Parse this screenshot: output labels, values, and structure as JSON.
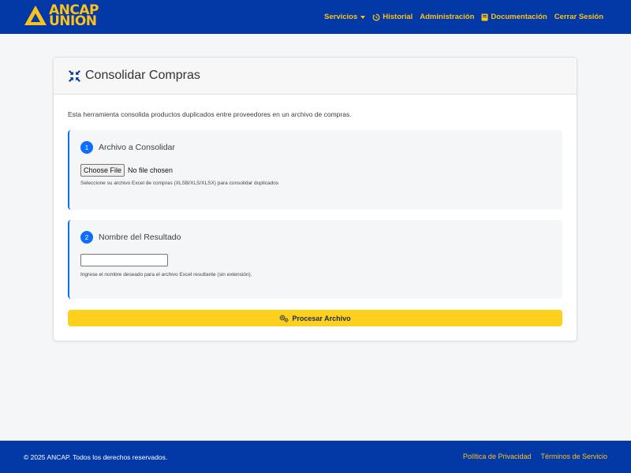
{
  "brand": {
    "line1": "ANCAP",
    "line2": "UNION",
    "color": "#fbc21b",
    "icon": "ancap-triangle-logo"
  },
  "nav": {
    "servicios": "Servicios",
    "historial": "Historial",
    "administracion": "Administración",
    "documentacion": "Documentación",
    "cerrar_sesion": "Cerrar Sesión",
    "icons": {
      "historial": "history-icon",
      "documentacion": "book-icon",
      "servicios": "caret-down-icon"
    }
  },
  "card": {
    "title": "Consolidar Compras",
    "title_icon": "compress-arrows-icon",
    "intro": "Esta herramienta consolida productos duplicados entre proveedores en un archivo de compras."
  },
  "step1": {
    "number": "1",
    "label": "Archivo a Consolidar",
    "file_button": "Choose File",
    "file_status": "No file chosen",
    "help": "Seleccione su archivo Excel de compras (XLSB/XLS/XLSX) para consolidar duplicados"
  },
  "step2": {
    "number": "2",
    "label": "Nombre del Resultado",
    "input_value": "",
    "help": "Ingrese el nombre deseado para el archivo Excel resultante (sin extensión)."
  },
  "action": {
    "label": "Procesar Archivo",
    "icon": "gears-icon",
    "color": "#fcd01c"
  },
  "footer": {
    "copyright": "© 2025 ANCAP. Todos los derechos reservados.",
    "privacy": "Política de Privacidad",
    "terms": "Términos de Servicio"
  },
  "colors": {
    "navbar": "#0339a6",
    "accent": "#0d6efd",
    "link": "#fbc21b"
  }
}
